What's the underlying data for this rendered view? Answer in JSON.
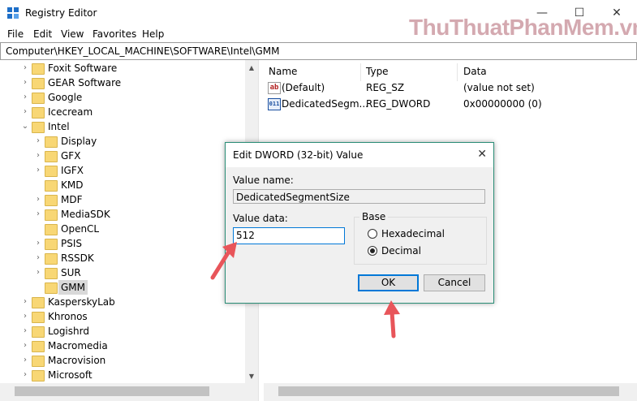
{
  "window": {
    "title": "Registry Editor",
    "watermark_parts": [
      "Thu",
      "Thuat",
      "Phan",
      "Mem",
      ".vn"
    ],
    "minimize": "—",
    "maximize": "☐",
    "close": "✕"
  },
  "menu": [
    "File",
    "Edit",
    "View",
    "Favorites",
    "Help"
  ],
  "address": "Computer\\HKEY_LOCAL_MACHINE\\SOFTWARE\\Intel\\GMM",
  "tree": [
    {
      "label": "Foxit Software",
      "level": 0,
      "expanded": false,
      "selected": false
    },
    {
      "label": "GEAR Software",
      "level": 0,
      "expanded": false,
      "selected": false
    },
    {
      "label": "Google",
      "level": 0,
      "expanded": false,
      "selected": false
    },
    {
      "label": "Icecream",
      "level": 0,
      "expanded": false,
      "selected": false
    },
    {
      "label": "Intel",
      "level": 0,
      "expanded": true,
      "selected": false
    },
    {
      "label": "Display",
      "level": 1,
      "expanded": false,
      "selected": false
    },
    {
      "label": "GFX",
      "level": 1,
      "expanded": false,
      "selected": false
    },
    {
      "label": "IGFX",
      "level": 1,
      "expanded": false,
      "selected": false
    },
    {
      "label": "KMD",
      "level": 1,
      "expanded": false,
      "selected": false,
      "noChevron": true
    },
    {
      "label": "MDF",
      "level": 1,
      "expanded": false,
      "selected": false
    },
    {
      "label": "MediaSDK",
      "level": 1,
      "expanded": false,
      "selected": false
    },
    {
      "label": "OpenCL",
      "level": 1,
      "expanded": false,
      "selected": false,
      "noChevron": true
    },
    {
      "label": "PSIS",
      "level": 1,
      "expanded": false,
      "selected": false
    },
    {
      "label": "RSSDK",
      "level": 1,
      "expanded": false,
      "selected": false
    },
    {
      "label": "SUR",
      "level": 1,
      "expanded": false,
      "selected": false
    },
    {
      "label": "GMM",
      "level": 1,
      "expanded": false,
      "selected": true,
      "noChevron": true
    },
    {
      "label": "KasperskyLab",
      "level": 0,
      "expanded": false,
      "selected": false
    },
    {
      "label": "Khronos",
      "level": 0,
      "expanded": false,
      "selected": false
    },
    {
      "label": "Logishrd",
      "level": 0,
      "expanded": false,
      "selected": false
    },
    {
      "label": "Macromedia",
      "level": 0,
      "expanded": false,
      "selected": false
    },
    {
      "label": "Macrovision",
      "level": 0,
      "expanded": false,
      "selected": false
    },
    {
      "label": "Microsoft",
      "level": 0,
      "expanded": false,
      "selected": false
    }
  ],
  "list": {
    "columns": [
      "Name",
      "Type",
      "Data"
    ],
    "rows": [
      {
        "icon": "ab",
        "icon_name": "string-value-icon",
        "name": "(Default)",
        "type": "REG_SZ",
        "data": "(value not set)"
      },
      {
        "icon": "011",
        "icon_name": "binary-value-icon",
        "name": "DedicatedSegm...",
        "type": "REG_DWORD",
        "data": "0x00000000 (0)"
      }
    ]
  },
  "dialog": {
    "title": "Edit DWORD (32-bit) Value",
    "value_name_label": "Value name:",
    "value_name": "DedicatedSegmentSize",
    "value_data_label": "Value data:",
    "value_data": "512",
    "base_label": "Base",
    "hex_label": "Hexadecimal",
    "dec_label": "Decimal",
    "selected_base": "Decimal",
    "ok": "OK",
    "cancel": "Cancel"
  },
  "colors": {
    "accent": "#0078d7",
    "arrow": "#e8555a",
    "folder": "#f8d775",
    "dialog_border": "#2a8d76"
  }
}
